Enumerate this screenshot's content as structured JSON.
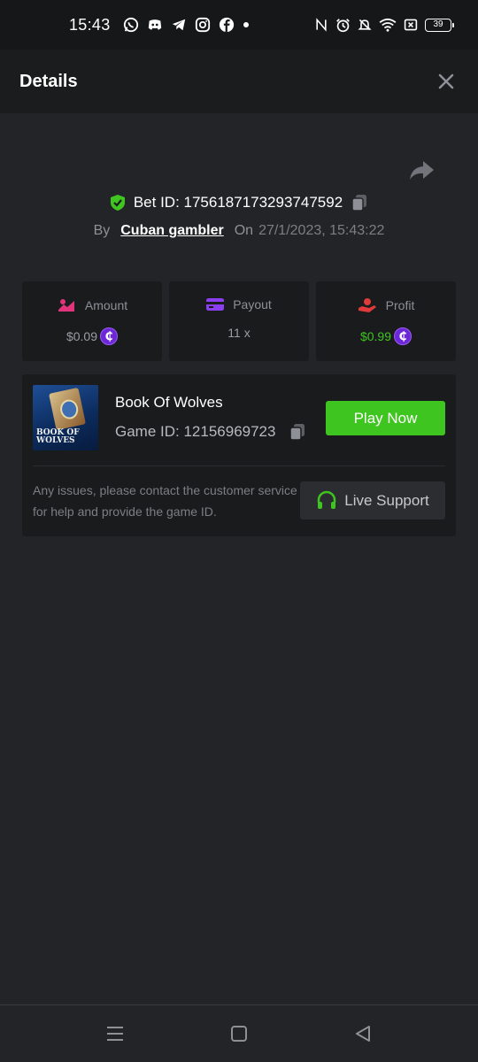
{
  "status_bar": {
    "time": "15:43",
    "battery": "39",
    "app_icons": [
      "whatsapp-icon",
      "discord-icon",
      "telegram-icon",
      "instagram-icon",
      "facebook-icon"
    ],
    "system_icons": [
      "nfc-icon",
      "alarm-icon",
      "mute-icon",
      "wifi-icon",
      "no-sim-icon"
    ]
  },
  "header": {
    "title": "Details"
  },
  "bet": {
    "id_label": "Bet ID: 1756187173293747592",
    "by_label": "By",
    "user": "Cuban gambler",
    "on_label": "On",
    "date": "27/1/2023, 15:43:22"
  },
  "stats": {
    "amount": {
      "label": "Amount",
      "value": "$0.09"
    },
    "payout": {
      "label": "Payout",
      "value": "11 x"
    },
    "profit": {
      "label": "Profit",
      "value": "$0.99"
    }
  },
  "coin_symbol": "₵",
  "game": {
    "title": "Book Of Wolves",
    "id_label": "Game ID: 12156969723",
    "thumb_text_1": "BOOK OF",
    "thumb_text_2": "WOLVES",
    "play_label": "Play Now",
    "issue_text": "Any issues, please contact the customer service for help and provide the game ID.",
    "support_label": "Live Support"
  },
  "colors": {
    "accent_green": "#3fc51f",
    "coin_purple": "#6b27d8",
    "amount_pink": "#e0357a",
    "payout_purple": "#8b3ff0",
    "profit_red": "#e03a3a"
  }
}
